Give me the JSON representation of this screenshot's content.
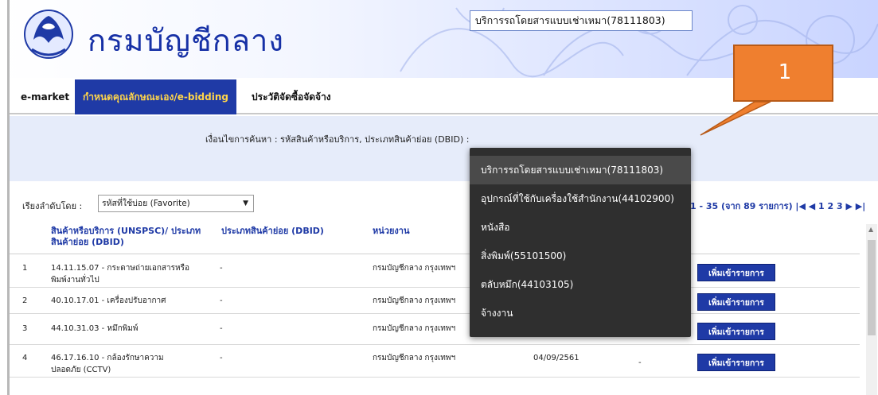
{
  "header": {
    "brand_text": "กรมบัญชีกลาง"
  },
  "nav": {
    "items": [
      {
        "label": "e-market",
        "active": false
      },
      {
        "label": "กำหนดคุณลักษณะเอง/e-bidding",
        "active": true
      },
      {
        "label": "ประวัติจัดซื้อจัดจ้าง",
        "active": false
      }
    ]
  },
  "search": {
    "label": "เงื่อนไขการค้นหา : รหัสสินค้าหรือบริการ, ประเภทสินค้าย่อย (DBID) :",
    "value": "บริการรถโดยสารแบบเช่าเหมา(78111803)"
  },
  "autocomplete": {
    "items": [
      "บริการรถโดยสารแบบเช่าเหมา(78111803)",
      "อุปกรณ์ที่ใช้กับเครื่องใช้สำนักงาน(44102900)",
      "หนังสือ",
      "สิ่งพิมพ์(55101500)",
      "ตลับหมึก(44103105)",
      "จ้างงาน"
    ],
    "selected_index": 0
  },
  "sort": {
    "label": "เรียงลำดับโดย :",
    "selected": "รหัสที่ใช้บ่อย (Favorite)",
    "arrow": "▼"
  },
  "paging": {
    "text": "1 - 35 (จาก 89 รายการ)  |◀ ◀  1 2 3 ▶ ▶|"
  },
  "table": {
    "headers": {
      "product": "สินค้าหรือบริการ (UNSPSC)/ ประเภทสินค้าย่อย (DBID)",
      "subtype": "ประเภทสินค้าย่อย (DBID)",
      "agency": "หน่วยงาน"
    },
    "rows": [
      {
        "no": "1",
        "product": "14.11.15.07 - กระดาษถ่ายเอกสารหรือพิมพ์งานทั่วไป",
        "subtype": "-",
        "agency": "กรมบัญชีกลาง กรุงเทพฯ",
        "date": "",
        "extra": "",
        "button": "เพิ่มเข้ารายการ"
      },
      {
        "no": "2",
        "product": "40.10.17.01 - เครื่องปรับอากาศ",
        "subtype": "-",
        "agency": "กรมบัญชีกลาง กรุงเทพฯ",
        "date": "",
        "extra": "",
        "button": "เพิ่มเข้ารายการ"
      },
      {
        "no": "3",
        "product": "44.10.31.03 - หมึกพิมพ์",
        "subtype": "-",
        "agency": "กรมบัญชีกลาง กรุงเทพฯ",
        "date": "",
        "extra": "",
        "button": "เพิ่มเข้ารายการ"
      },
      {
        "no": "4",
        "product": "46.17.16.10 - กล้องรักษาความปลอดภัย (CCTV)",
        "subtype": "-",
        "agency": "กรมบัญชีกลาง กรุงเทพฯ",
        "date": "04/09/2561",
        "extra": "-",
        "button": "เพิ่มเข้ารายการ"
      }
    ]
  },
  "callout": {
    "number": "1"
  },
  "colors": {
    "brand_blue": "#1f3aa6",
    "active_tab_text": "#ffd54a",
    "callout_orange": "#ef7f2f",
    "dropdown_bg": "#2f2f2f"
  }
}
